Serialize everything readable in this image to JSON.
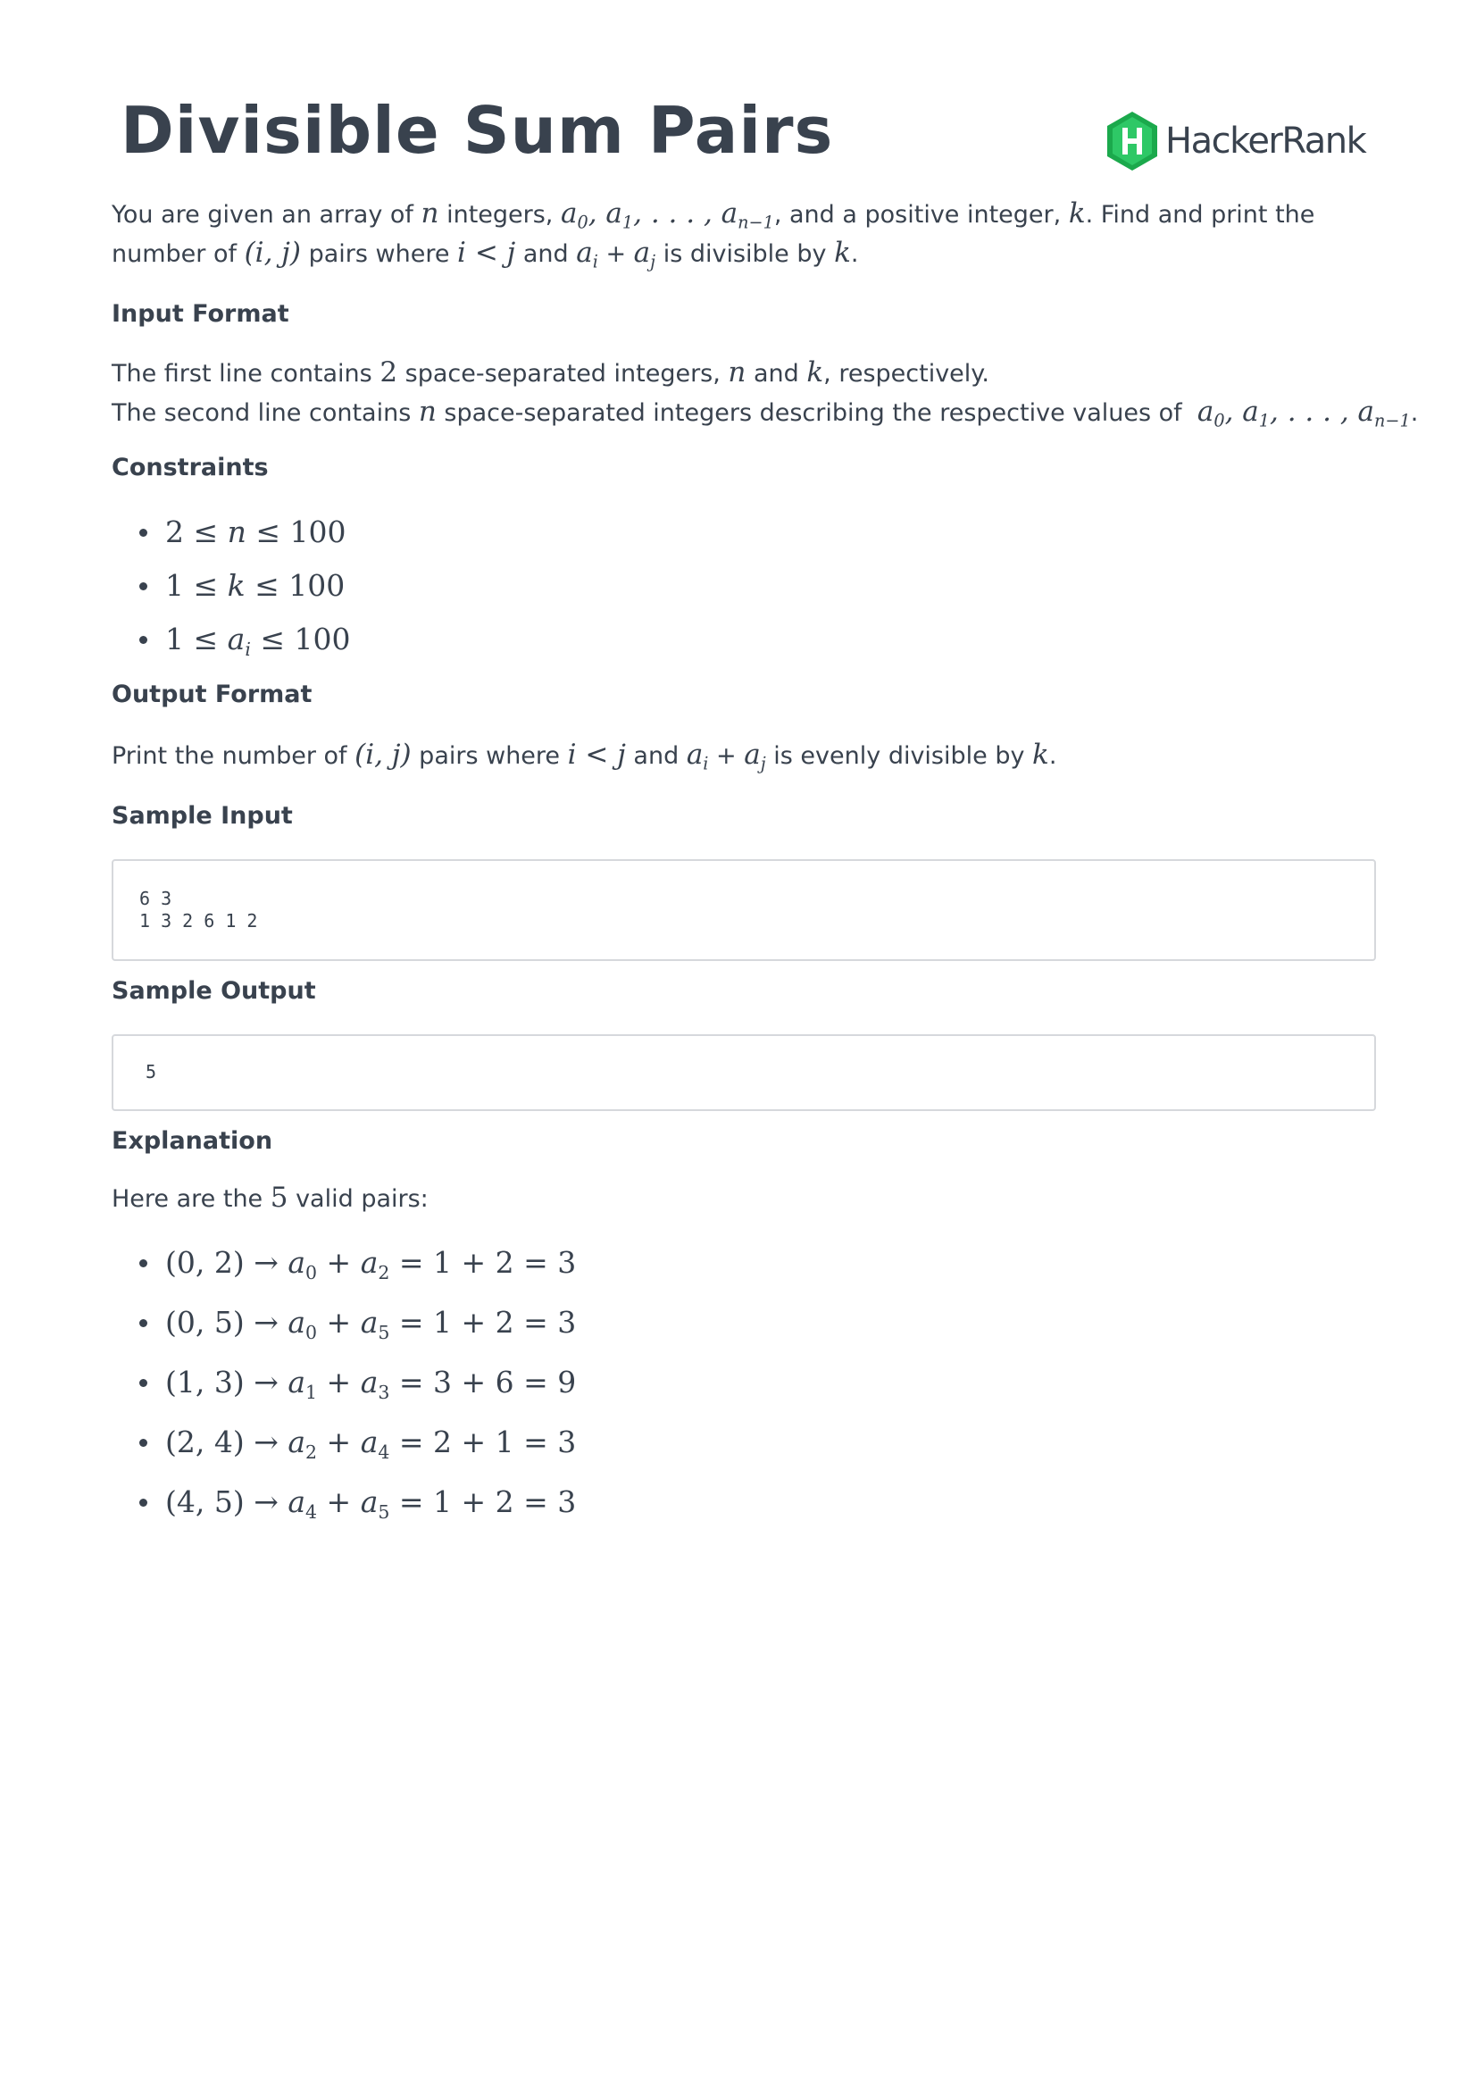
{
  "title": "Divisible Sum Pairs",
  "logo": {
    "text": "HackerRank",
    "color": "#1ba94c"
  },
  "sections": {
    "input_format": "Input Format",
    "constraints": "Constraints",
    "output_format": "Output Format",
    "sample_input": "Sample Input",
    "sample_output": "Sample Output",
    "explanation": "Explanation"
  },
  "sample_input_lines": [
    "6 3",
    "1 3 2 6 1 2"
  ],
  "sample_output_lines": [
    "5"
  ],
  "pairs": [
    "(0, 2) → a0 + a2 = 1 + 2 = 3",
    "(0, 5) → a0 + a5 = 1 + 2 = 3",
    "(1, 3) → a1 + a3 = 3 + 6 = 9",
    "(2, 4) → a2 + a4 = 2 + 1 = 3",
    "(4, 5) → a4 + a5 = 1 + 2 = 3"
  ]
}
